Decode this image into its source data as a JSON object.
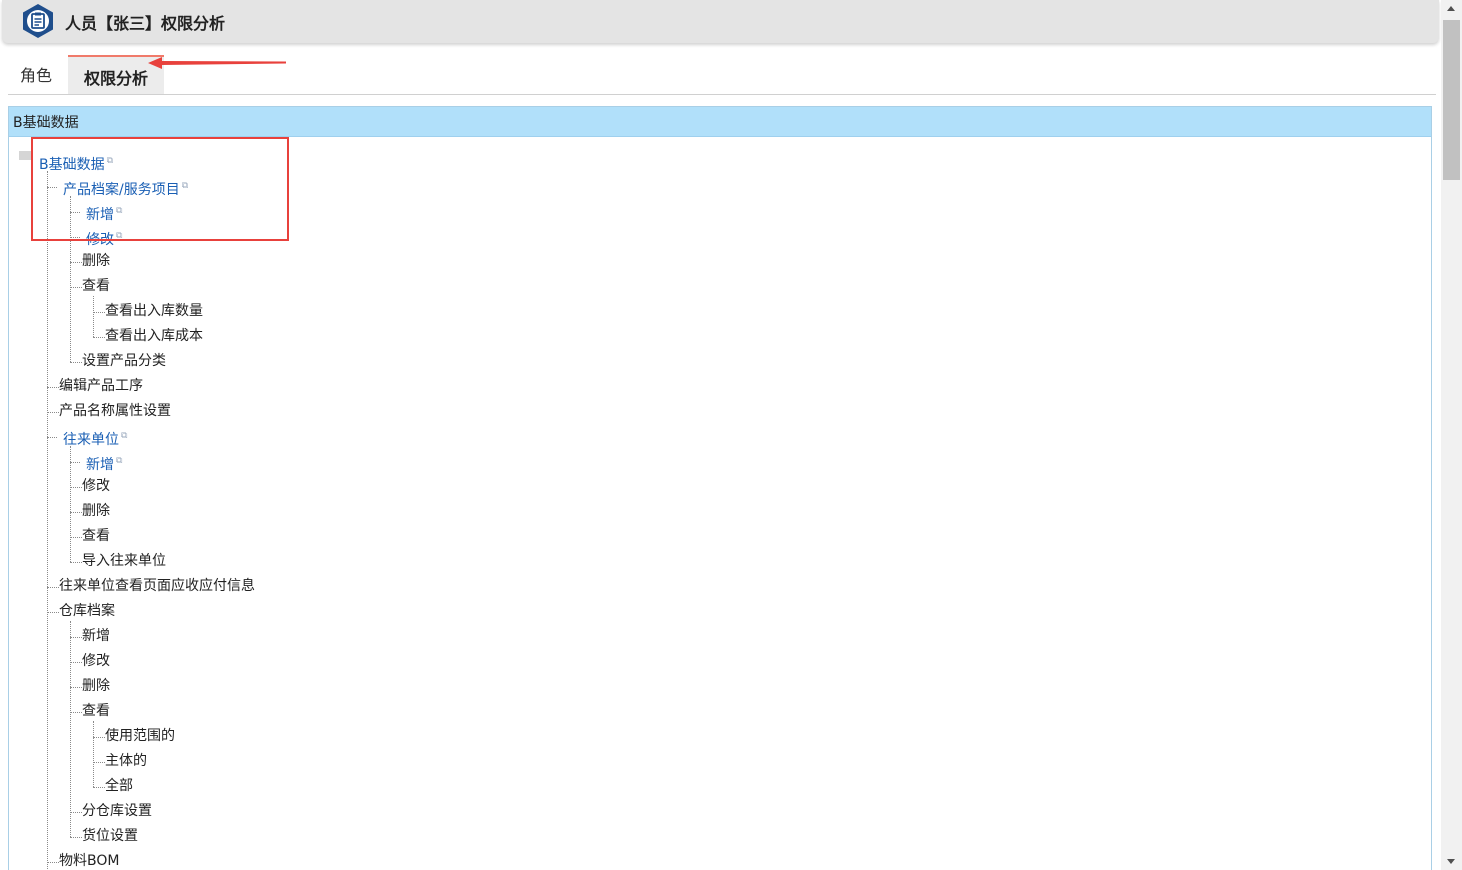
{
  "window": {
    "title": "人员【张三】权限分析",
    "app_icon": "clipboard-badge-icon"
  },
  "tabs": [
    {
      "label": "角色",
      "active": false
    },
    {
      "label": "权限分析",
      "active": true
    }
  ],
  "panel": {
    "header": "B基础数据"
  },
  "tree": {
    "link_color": "#1a5fb4",
    "external_link_icon": "external-link-icon",
    "nodes": [
      {
        "label": "B基础数据",
        "level": 0,
        "link": true
      },
      {
        "label": "产品档案/服务项目",
        "level": 1,
        "link": true
      },
      {
        "label": "新增",
        "level": 2,
        "link": true
      },
      {
        "label": "修改",
        "level": 2,
        "link": true
      },
      {
        "label": "删除",
        "level": 2,
        "link": false
      },
      {
        "label": "查看",
        "level": 2,
        "link": false
      },
      {
        "label": "查看出入库数量",
        "level": 3,
        "link": false
      },
      {
        "label": "查看出入库成本",
        "level": 3,
        "link": false
      },
      {
        "label": "设置产品分类",
        "level": 2,
        "link": false
      },
      {
        "label": "编辑产品工序",
        "level": 1,
        "link": false
      },
      {
        "label": "产品名称属性设置",
        "level": 1,
        "link": false
      },
      {
        "label": "往来单位",
        "level": 1,
        "link": true
      },
      {
        "label": "新增",
        "level": 2,
        "link": true
      },
      {
        "label": "修改",
        "level": 2,
        "link": false
      },
      {
        "label": "删除",
        "level": 2,
        "link": false
      },
      {
        "label": "查看",
        "level": 2,
        "link": false
      },
      {
        "label": "导入往来单位",
        "level": 2,
        "link": false
      },
      {
        "label": "往来单位查看页面应收应付信息",
        "level": 1,
        "link": false
      },
      {
        "label": "仓库档案",
        "level": 1,
        "link": false
      },
      {
        "label": "新增",
        "level": 2,
        "link": false
      },
      {
        "label": "修改",
        "level": 2,
        "link": false
      },
      {
        "label": "删除",
        "level": 2,
        "link": false
      },
      {
        "label": "查看",
        "level": 2,
        "link": false
      },
      {
        "label": "使用范围的",
        "level": 3,
        "link": false
      },
      {
        "label": "主体的",
        "level": 3,
        "link": false
      },
      {
        "label": "全部",
        "level": 3,
        "link": false
      },
      {
        "label": "分仓库设置",
        "level": 2,
        "link": false
      },
      {
        "label": "货位设置",
        "level": 2,
        "link": false
      },
      {
        "label": "物料BOM",
        "level": 1,
        "link": false
      }
    ]
  },
  "annotations": {
    "highlight_color": "#e8413c",
    "arrow_color": "#e8413c"
  }
}
